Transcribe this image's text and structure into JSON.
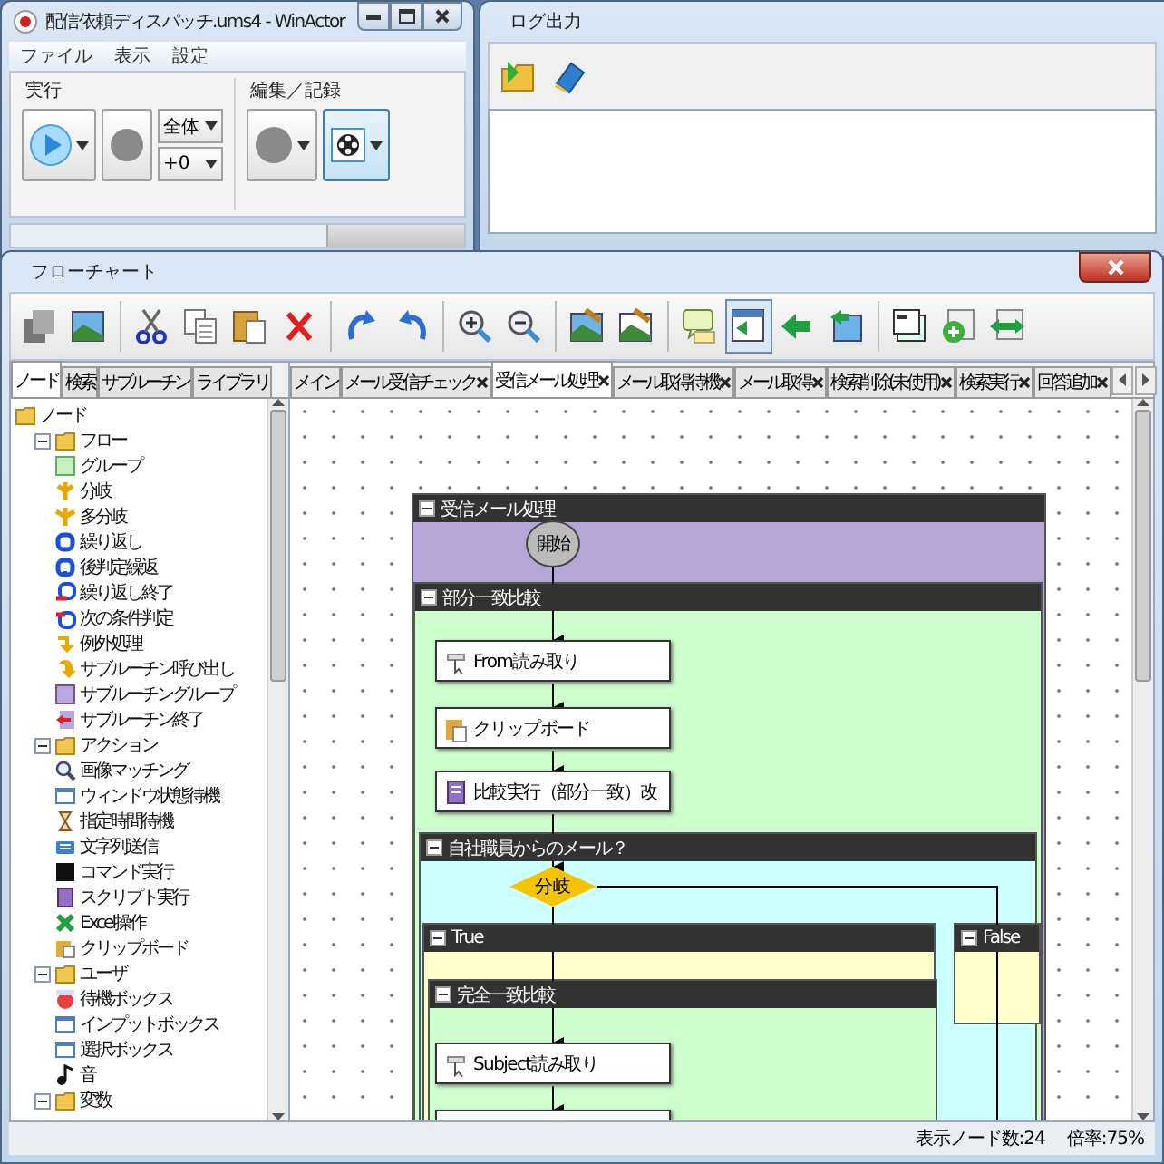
{
  "main_window": {
    "title": "配信依頼ディスパッチ.ums4 - WinActor",
    "menu": [
      {
        "label": "ファイル"
      },
      {
        "label": "表示"
      },
      {
        "label": "設定"
      }
    ],
    "groups": [
      {
        "label": "実行"
      },
      {
        "label": "編集／記録"
      }
    ],
    "dropdowns": [
      {
        "value": "全体"
      },
      {
        "value": "+0"
      }
    ]
  },
  "log_window": {
    "title": "ログ出力"
  },
  "flowchart_window": {
    "title": "フローチャート",
    "toolbar": [
      {
        "selected": false
      },
      {
        "selected": false
      },
      {
        "selected": false
      },
      {
        "selected": false
      },
      {
        "selected": false
      },
      {
        "selected": false
      },
      {
        "selected": false
      },
      {
        "selected": false
      },
      {
        "selected": false
      },
      {
        "selected": false
      },
      {
        "selected": false
      },
      {
        "selected": false
      },
      {
        "selected": false
      },
      {
        "selected": true
      },
      {
        "selected": false
      },
      {
        "selected": false
      },
      {
        "selected": false
      },
      {
        "selected": false
      },
      {
        "selected": false
      }
    ],
    "panel_tabs": [
      {
        "label": "ノード",
        "selected": true
      },
      {
        "label": "検索",
        "selected": false
      },
      {
        "label": "サブルーチン",
        "selected": false
      },
      {
        "label": "ライブラリ",
        "selected": false
      }
    ],
    "tree": [
      {
        "label": "ノード",
        "children": [
          {
            "label": "フロー",
            "expanded": true,
            "children": [
              {
                "label": "グループ"
              },
              {
                "label": "分岐"
              },
              {
                "label": "多分岐"
              },
              {
                "label": "繰り返し"
              },
              {
                "label": "後判定繰返"
              },
              {
                "label": "繰り返し終了"
              },
              {
                "label": "次の条件判定"
              },
              {
                "label": "例外処理"
              },
              {
                "label": "サブルーチン呼び出し"
              },
              {
                "label": "サブルーチングループ"
              },
              {
                "label": "サブルーチン終了"
              }
            ]
          },
          {
            "label": "アクション",
            "expanded": true,
            "children": [
              {
                "label": "画像マッチング"
              },
              {
                "label": "ウィンドウ状態待機"
              },
              {
                "label": "指定時間待機"
              },
              {
                "label": "文字列送信"
              },
              {
                "label": "コマンド実行"
              },
              {
                "label": "スクリプト実行"
              },
              {
                "label": "Excel操作"
              },
              {
                "label": "クリップボード"
              }
            ]
          },
          {
            "label": "ユーザ",
            "expanded": true,
            "children": [
              {
                "label": "待機ボックス"
              },
              {
                "label": "インプットボックス"
              },
              {
                "label": "選択ボックス"
              },
              {
                "label": "音"
              }
            ]
          },
          {
            "label": "変数",
            "expanded": true
          }
        ]
      }
    ],
    "tabs": [
      {
        "label": "メイン",
        "selected": false,
        "closable": false
      },
      {
        "label": "メール受信チェック",
        "selected": false,
        "closable": true
      },
      {
        "label": "受信メール処理",
        "selected": true,
        "closable": true
      },
      {
        "label": "メール取得待機",
        "selected": false,
        "closable": true
      },
      {
        "label": "メール取得",
        "selected": false,
        "closable": true
      },
      {
        "label": "検索削除(未使用)",
        "selected": false,
        "closable": true
      },
      {
        "label": "検索実行",
        "selected": false,
        "closable": true
      },
      {
        "label": "回答追加",
        "selected": false,
        "closable": true
      }
    ],
    "diagram": {
      "groups": [
        {
          "title": "受信メール処理",
          "color": "#b4a6d6"
        },
        {
          "title": "部分一致比較",
          "color": "#ccffcc"
        },
        {
          "title": "自社職員からのメール？",
          "color": "#ccffff"
        },
        {
          "title": "True",
          "color": "#ffffcc"
        },
        {
          "title": "False",
          "color": "#ffffcc"
        },
        {
          "title": "完全一致比較",
          "color": "#ccffcc"
        }
      ],
      "start": {
        "label": "開始"
      },
      "branch": {
        "label": "分岐"
      },
      "nodes": [
        {
          "label": "From読み取り"
        },
        {
          "label": "クリップボード"
        },
        {
          "label": "比較実行（部分一致）改"
        },
        {
          "label": "Subject読み取り"
        }
      ]
    },
    "status": [
      {
        "text": "表示ノード数:24"
      },
      {
        "text": "倍率:75%"
      }
    ]
  }
}
